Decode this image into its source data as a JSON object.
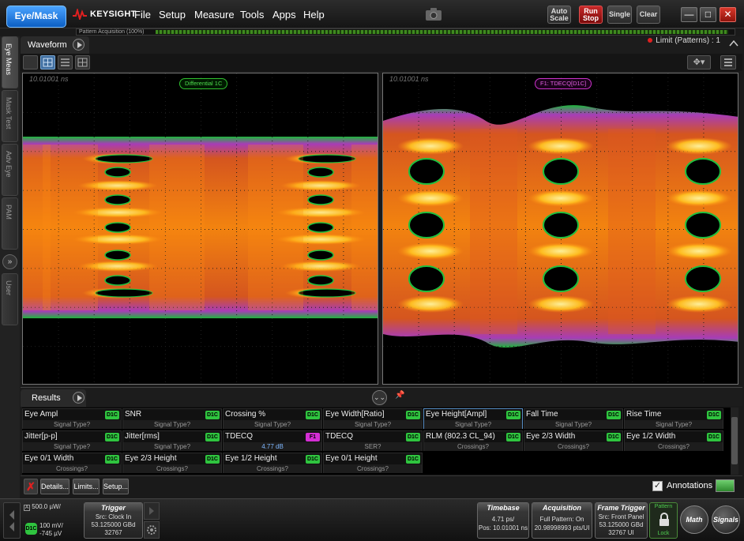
{
  "topbar": {
    "mode_button": "Eye/Mask",
    "brand": "KEYSIGHT",
    "menus": [
      "File",
      "Setup",
      "Measure",
      "Tools",
      "Apps",
      "Help"
    ],
    "auto_scale": "Auto Scale",
    "run_stop": "Run Stop",
    "single": "Single",
    "clear": "Clear",
    "progress_label": "Pattern Acquisition",
    "progress_value": "(100%)",
    "progress_fraction": 1.0
  },
  "side_tabs": [
    "Eye Meas",
    "Mask Test",
    "Adv Eye",
    "PAM",
    "User"
  ],
  "waveform": {
    "tab_label": "Waveform",
    "limit_text": "Limit (Patterns) : 1"
  },
  "panes": [
    {
      "time": "10.01001 ns",
      "label": "Differential 1C",
      "color": "#33cc33"
    },
    {
      "time": "10.01001 ns",
      "label": "F1: TDECQ[D1C]",
      "color": "#cc33cc"
    }
  ],
  "results": {
    "tab_label": "Results",
    "rows": [
      [
        {
          "name": "Eye Ampl",
          "badge": "D1C",
          "sub": "Signal Type?"
        },
        {
          "name": "SNR",
          "badge": "D1C",
          "sub": "Signal Type?"
        },
        {
          "name": "Crossing %",
          "badge": "D1C",
          "sub": "Signal Type?"
        },
        {
          "name": "Eye Width[Ratio]",
          "badge": "D1C",
          "sub": "Signal Type?"
        },
        {
          "name": "Eye Height[Ampl]",
          "badge": "D1C",
          "sub": "Signal Type?"
        },
        {
          "name": "Fall Time",
          "badge": "D1C",
          "sub": "Signal Type?"
        },
        {
          "name": "Rise Time",
          "badge": "D1C",
          "sub": "Signal Type?"
        }
      ],
      [
        {
          "name": "Jitter[p-p]",
          "badge": "D1C",
          "sub": "Signal Type?"
        },
        {
          "name": "Jitter[rms]",
          "badge": "D1C",
          "sub": "Signal Type?"
        },
        {
          "name": "TDECQ",
          "badge": "F1",
          "sub": "4.77 dB"
        },
        {
          "name": "TDECQ",
          "badge": "D1C",
          "sub": "SER?"
        },
        {
          "name": "RLM (802.3 CL_94)",
          "badge": "D1C",
          "sub": "Crossings?"
        },
        {
          "name": "Eye 2/3 Width",
          "badge": "D1C",
          "sub": "Crossings?"
        },
        {
          "name": "Eye 1/2 Width",
          "badge": "D1C",
          "sub": "Crossings?"
        }
      ],
      [
        {
          "name": "Eye 0/1 Width",
          "badge": "D1C",
          "sub": "Crossings?"
        },
        {
          "name": "Eye 2/3 Height",
          "badge": "D1C",
          "sub": "Crossings?"
        },
        {
          "name": "Eye 1/2 Height",
          "badge": "D1C",
          "sub": "Crossings?"
        },
        {
          "name": "Eye 0/1 Height",
          "badge": "D1C",
          "sub": "Crossings?"
        }
      ]
    ],
    "details": "Details...",
    "limits": "Limits...",
    "setup": "Setup...",
    "annotations": "Annotations"
  },
  "bottom": {
    "channel_scale": "500.0 µW/",
    "chip": "D1C",
    "ch_line1": "100 mV/",
    "ch_line2": "-745 µV",
    "trigger": {
      "title": "Trigger",
      "l1": "Src: Clock In",
      "l2": "53.125000 GBd",
      "l3": "32767"
    },
    "timebase": {
      "title": "Timebase",
      "l1": "4.71 ps/",
      "l2": "Pos: 10.01001 ns"
    },
    "acquisition": {
      "title": "Acquisition",
      "l1": "Full Pattern: On",
      "l2": "20.98998993 pts/UI"
    },
    "frame_trigger": {
      "title": "Frame Trigger",
      "l1": "Src: Front Panel",
      "l2": "53.125000 GBd",
      "l3": "32767 UI"
    },
    "pattern_label": "Pattern",
    "lock_label": "Lock",
    "math": "Math",
    "signals": "Signals"
  },
  "colors": {
    "accent": "#0c5fc4",
    "run_stop": "#c92a2a",
    "badge_d1c": "#2fc43f",
    "badge_f1": "#d42ed4"
  }
}
